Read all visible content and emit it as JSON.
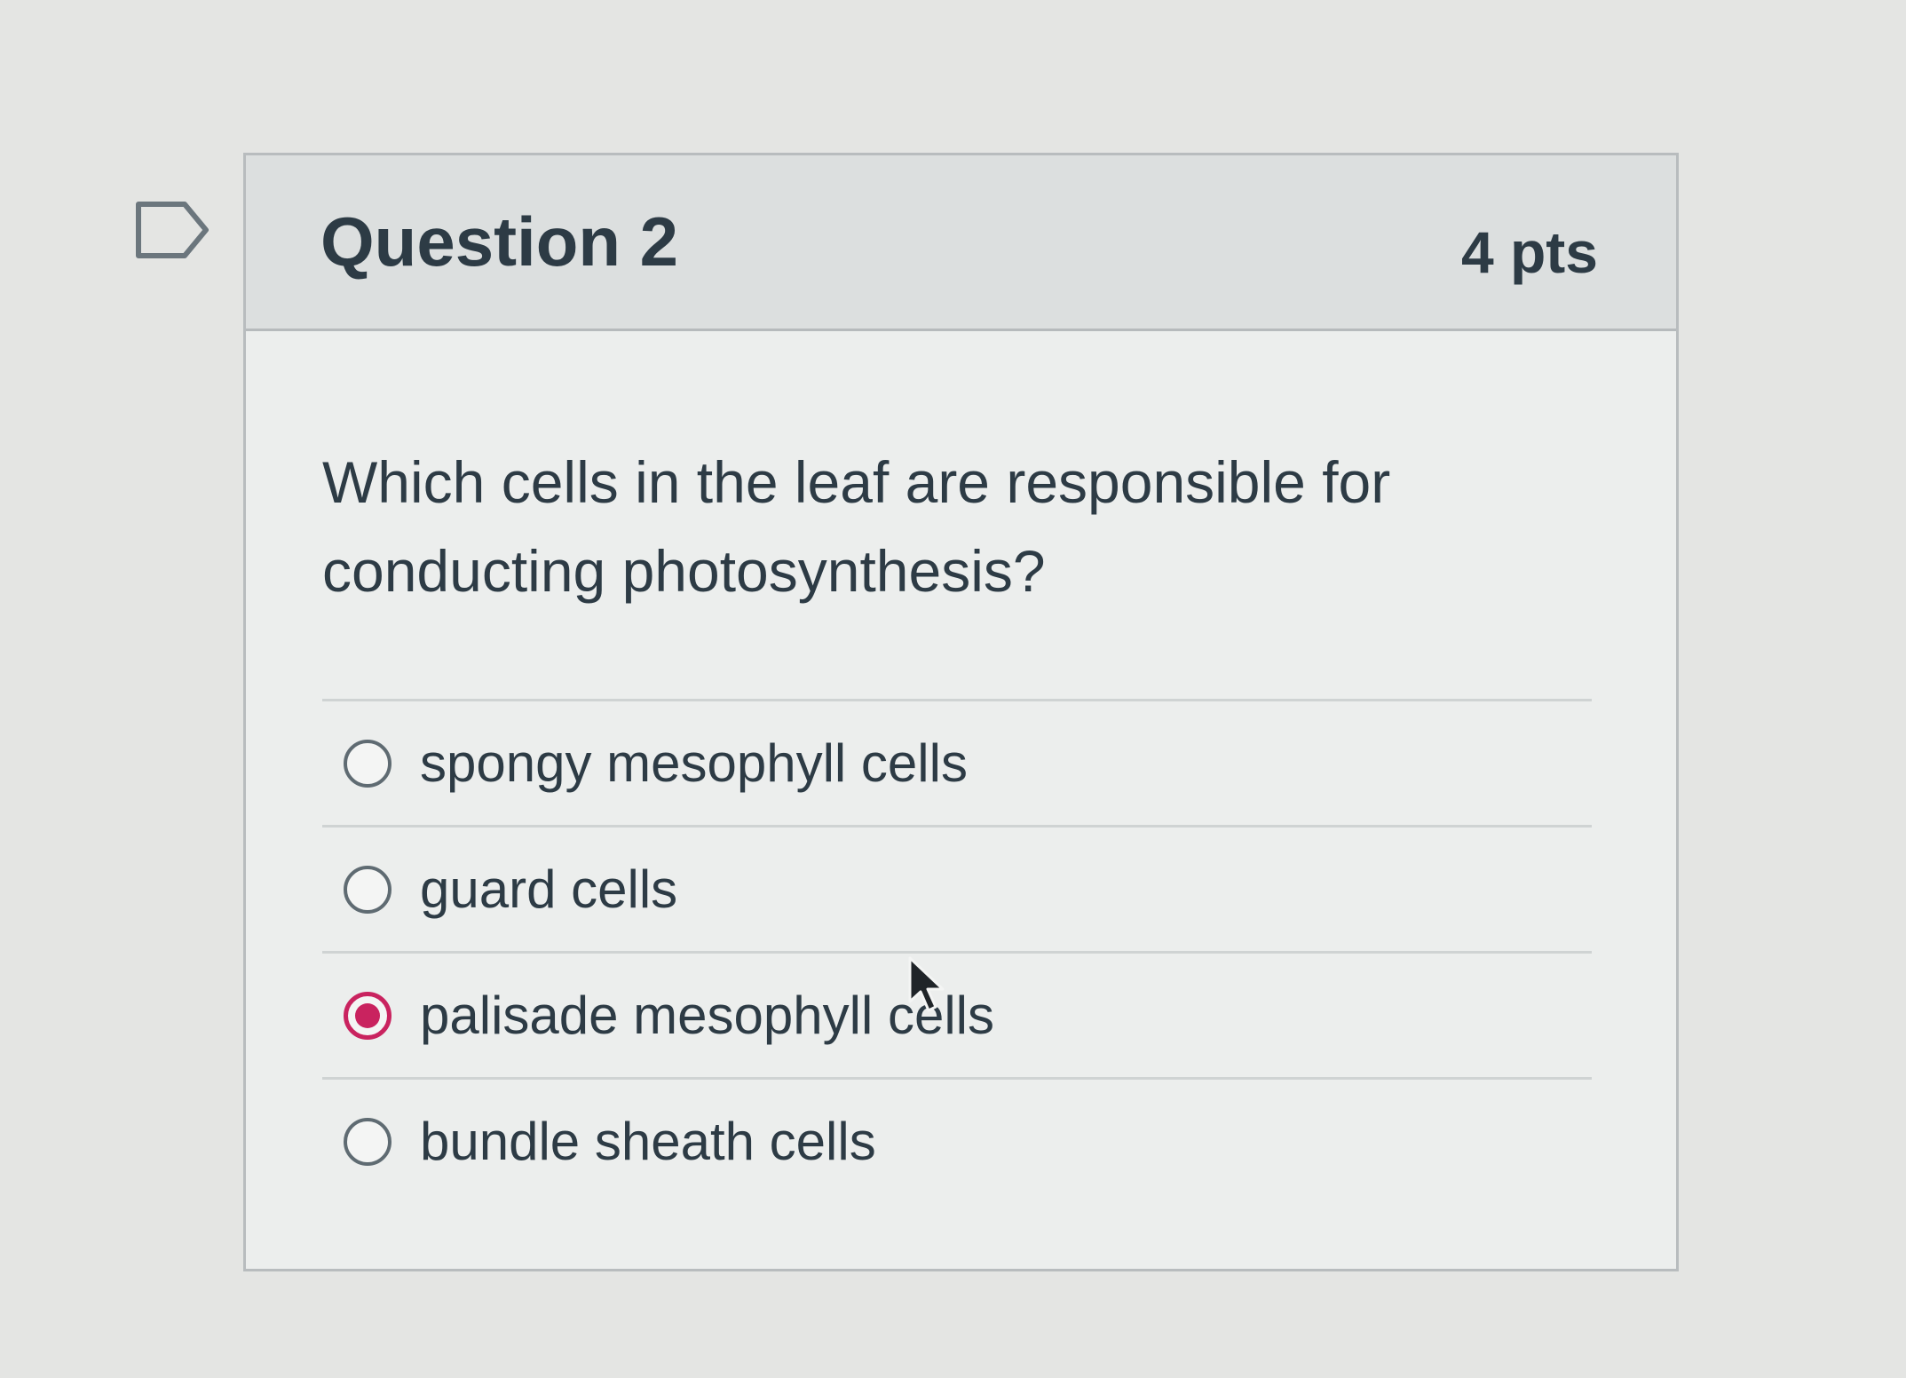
{
  "question": {
    "title": "Question 2",
    "points": "4 pts",
    "text": "Which cells in the leaf are responsible for conducting photosynthesis?"
  },
  "answers": [
    {
      "label": "spongy mesophyll cells",
      "selected": false
    },
    {
      "label": "guard cells",
      "selected": false
    },
    {
      "label": "palisade mesophyll cells",
      "selected": true
    },
    {
      "label": "bundle sheath cells",
      "selected": false
    }
  ],
  "colors": {
    "accent": "#c9235f",
    "text": "#2d3b45",
    "header_bg": "#dcdfdf"
  },
  "icons": {
    "flag": "flag-outline-icon",
    "cursor": "mouse-pointer-icon"
  }
}
